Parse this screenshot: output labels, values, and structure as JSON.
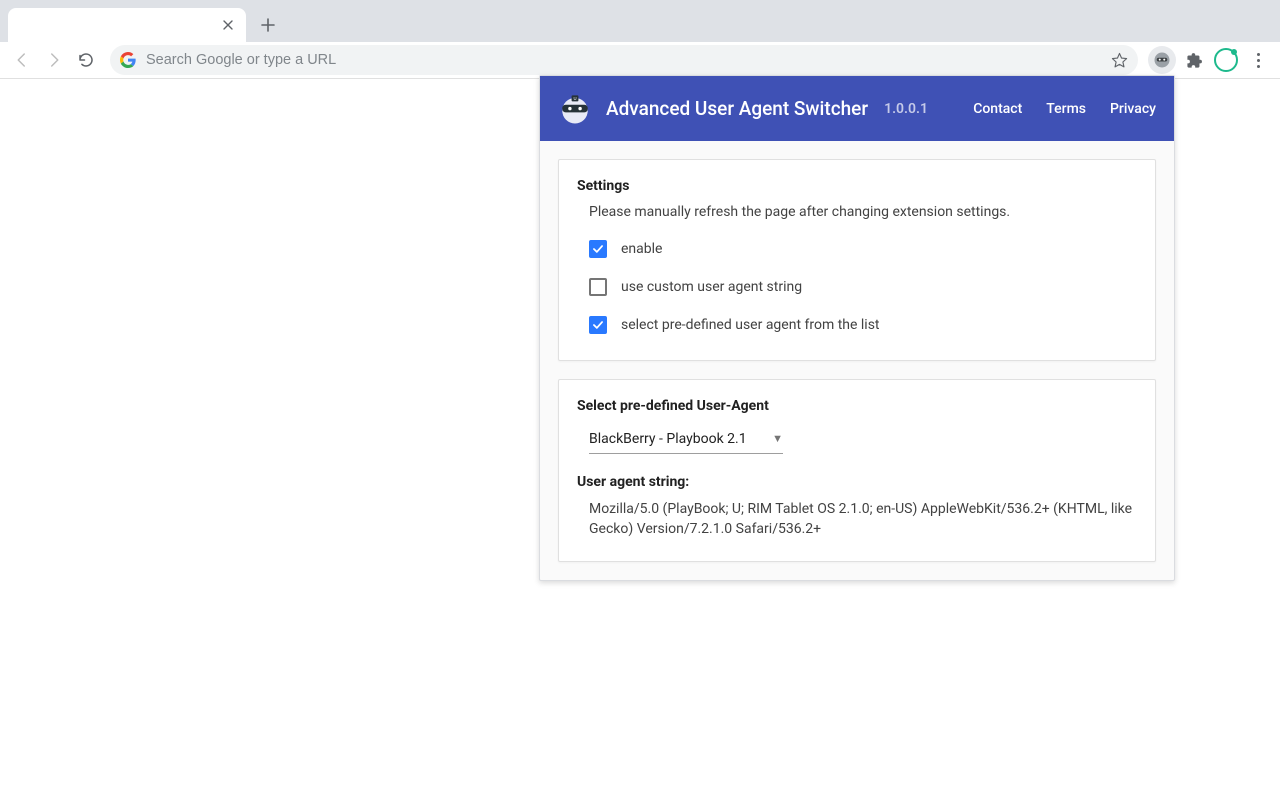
{
  "browser": {
    "omnibox_placeholder": "Search Google or type a URL"
  },
  "popup": {
    "title": "Advanced User Agent Switcher",
    "version": "1.0.0.1",
    "nav": {
      "contact": "Contact",
      "terms": "Terms",
      "privacy": "Privacy"
    },
    "settings": {
      "heading": "Settings",
      "note": "Please manually refresh the page after changing extension settings.",
      "options": {
        "enable": {
          "label": "enable",
          "checked": true
        },
        "custom": {
          "label": "use custom user agent string",
          "checked": false
        },
        "predefined": {
          "label": "select pre-defined user agent from the list",
          "checked": true
        }
      }
    },
    "predefined": {
      "heading": "Select pre-defined User-Agent",
      "selected": "BlackBerry - Playbook 2.1",
      "ua_label": "User agent string:",
      "ua_value": "Mozilla/5.0 (PlayBook; U; RIM Tablet OS 2.1.0; en-US) AppleWebKit/536.2+ (KHTML, like Gecko) Version/7.2.1.0 Safari/536.2+"
    }
  }
}
